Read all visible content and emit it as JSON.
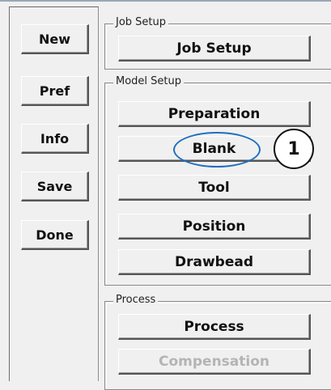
{
  "sidebar": {
    "buttons": [
      "New",
      "Pref",
      "Info",
      "Save",
      "Done"
    ]
  },
  "groups": {
    "job_setup": {
      "label": "Job Setup",
      "buttons": [
        "Job Setup"
      ]
    },
    "model_setup": {
      "label": "Model Setup",
      "buttons": [
        "Preparation",
        "Blank",
        "Tool",
        "Position",
        "Drawbead"
      ]
    },
    "process": {
      "label": "Process",
      "buttons": [
        "Process",
        "Compensation"
      ],
      "disabled_button": "Compensation"
    }
  },
  "annotation": {
    "callout_number": "1",
    "highlighted_button": "Blank",
    "highlight_color": "#1f6fbf"
  }
}
